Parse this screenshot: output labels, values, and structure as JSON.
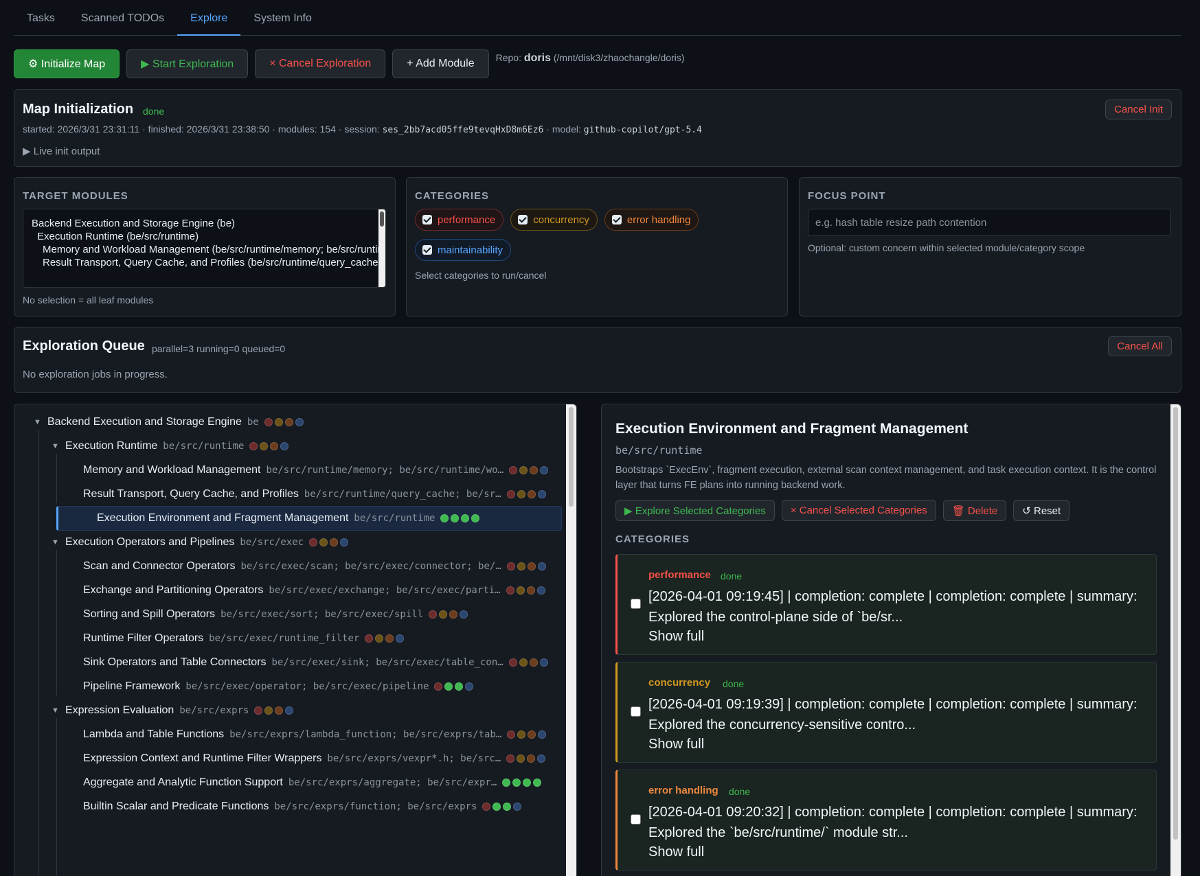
{
  "tabs": [
    "Tasks",
    "Scanned TODOs",
    "Explore",
    "System Info"
  ],
  "toolbar": {
    "init_label": "⚙ Initialize Map",
    "start_label": "▶ Start Exploration",
    "cancel_label": "× Cancel Exploration",
    "add_label": "+ Add Module",
    "repo_prefix": "Repo:",
    "repo_name": "doris",
    "repo_path": "(/mnt/disk3/zhaochangle/doris)"
  },
  "init": {
    "title": "Map Initialization",
    "status": "done",
    "started_label": "started:",
    "started": "2026/3/31 23:31:11",
    "finished_label": "· finished:",
    "finished": "2026/3/31 23:38:50",
    "modules_label": "· modules:",
    "modules": "154",
    "session_label": "· session:",
    "session": "ses_2bb7acd05ffe9tevqHxD8m6Ez6",
    "model_label": "· model:",
    "model": "github-copilot/gpt-5.4",
    "live_output": "▶ Live init output",
    "cancel_label": "Cancel Init"
  },
  "target": {
    "label": "TARGET MODULES",
    "items": [
      "Backend Execution and Storage Engine (be)",
      "Execution Runtime (be/src/runtime)",
      "Memory and Workload Management (be/src/runtime/memory; be/src/runtime/workload_management)",
      "Result Transport, Query Cache, and Profiles (be/src/runtime/query_cache; be/src/runtime/result)"
    ],
    "hint": "No selection = all leaf modules"
  },
  "categories": {
    "label": "CATEGORIES",
    "items": [
      "performance",
      "concurrency",
      "error handling",
      "maintainability"
    ],
    "hint": "Select categories to run/cancel"
  },
  "focus": {
    "label": "FOCUS POINT",
    "placeholder": "e.g. hash table resize path contention",
    "hint": "Optional: custom concern within selected module/category scope"
  },
  "queue": {
    "title": "Exploration Queue",
    "stats": "parallel=3 running=0 queued=0",
    "empty": "No exploration jobs in progress.",
    "cancel_label": "Cancel All"
  },
  "colors": {
    "red": "#da3633",
    "amber": "#bb8009",
    "orange": "#bd561d",
    "blue": "#1f6feb",
    "red_dim": "#6e2b2b",
    "amber_dim": "#6b5216",
    "orange_dim": "#6c3c1c",
    "blue_dim": "#2a4670",
    "green": "#3fb950"
  },
  "tree": [
    {
      "level": 0,
      "caret": "▼",
      "name": "Backend Execution and Storage Engine",
      "path": "be",
      "dots": [
        "red_dim",
        "amber_dim",
        "orange_dim",
        "blue_dim"
      ]
    },
    {
      "level": 1,
      "caret": "▼",
      "name": "Execution Runtime",
      "path": "be/src/runtime",
      "dots": [
        "red_dim",
        "amber_dim",
        "orange_dim",
        "blue_dim"
      ]
    },
    {
      "level": 2,
      "caret": "",
      "name": "Memory and Workload Management",
      "path": "be/src/runtime/memory; be/src/runtime/wo…",
      "dots": [
        "red_dim",
        "amber_dim",
        "orange_dim",
        "blue_dim"
      ]
    },
    {
      "level": 2,
      "caret": "",
      "name": "Result Transport, Query Cache, and Profiles",
      "path": "be/src/runtime/query_cache; be/sr…",
      "dots": [
        "red_dim",
        "amber_dim",
        "orange_dim",
        "blue_dim"
      ]
    },
    {
      "level": 2,
      "caret": "",
      "name": "Execution Environment and Fragment Management",
      "path": "be/src/runtime",
      "dots": [
        "green",
        "green",
        "green",
        "green"
      ],
      "selected": true
    },
    {
      "level": 1,
      "caret": "▼",
      "name": "Execution Operators and Pipelines",
      "path": "be/src/exec",
      "dots": [
        "red_dim",
        "amber_dim",
        "orange_dim",
        "blue_dim"
      ]
    },
    {
      "level": 2,
      "caret": "",
      "name": "Scan and Connector Operators",
      "path": "be/src/exec/scan; be/src/exec/connector; be/…",
      "dots": [
        "red_dim",
        "amber_dim",
        "orange_dim",
        "blue_dim"
      ]
    },
    {
      "level": 2,
      "caret": "",
      "name": "Exchange and Partitioning Operators",
      "path": "be/src/exec/exchange; be/src/exec/parti…",
      "dots": [
        "red_dim",
        "amber_dim",
        "orange_dim",
        "blue_dim"
      ]
    },
    {
      "level": 2,
      "caret": "",
      "name": "Sorting and Spill Operators",
      "path": "be/src/exec/sort; be/src/exec/spill",
      "dots": [
        "red_dim",
        "amber_dim",
        "orange_dim",
        "blue_dim"
      ]
    },
    {
      "level": 2,
      "caret": "",
      "name": "Runtime Filter Operators",
      "path": "be/src/exec/runtime_filter",
      "dots": [
        "red_dim",
        "amber_dim",
        "orange_dim",
        "blue_dim"
      ]
    },
    {
      "level": 2,
      "caret": "",
      "name": "Sink Operators and Table Connectors",
      "path": "be/src/exec/sink; be/src/exec/table_con…",
      "dots": [
        "red_dim",
        "amber_dim",
        "orange_dim",
        "blue_dim"
      ]
    },
    {
      "level": 2,
      "caret": "",
      "name": "Pipeline Framework",
      "path": "be/src/exec/operator; be/src/exec/pipeline",
      "dots": [
        "red_dim",
        "green",
        "green",
        "blue_dim"
      ]
    },
    {
      "level": 1,
      "caret": "▼",
      "name": "Expression Evaluation",
      "path": "be/src/exprs",
      "dots": [
        "red_dim",
        "amber_dim",
        "orange_dim",
        "blue_dim"
      ]
    },
    {
      "level": 2,
      "caret": "",
      "name": "Lambda and Table Functions",
      "path": "be/src/exprs/lambda_function; be/src/exprs/tab…",
      "dots": [
        "red_dim",
        "amber_dim",
        "orange_dim",
        "blue_dim"
      ]
    },
    {
      "level": 2,
      "caret": "",
      "name": "Expression Context and Runtime Filter Wrappers",
      "path": "be/src/exprs/vexpr*.h; be/src…",
      "dots": [
        "red_dim",
        "amber_dim",
        "orange_dim",
        "blue_dim"
      ]
    },
    {
      "level": 2,
      "caret": "",
      "name": "Aggregate and Analytic Function Support",
      "path": "be/src/exprs/aggregate; be/src/expr…",
      "dots": [
        "green",
        "green",
        "green",
        "green"
      ]
    },
    {
      "level": 2,
      "caret": "",
      "name": "Builtin Scalar and Predicate Functions",
      "path": "be/src/exprs/function; be/src/exprs",
      "dots": [
        "red_dim",
        "green",
        "green",
        "blue_dim"
      ]
    }
  ],
  "detail": {
    "title": "Execution Environment and Fragment Management",
    "path": "be/src/runtime",
    "description": "Bootstraps `ExecEnv`, fragment execution, external scan context management, and task execution context. It is the control layer that turns FE plans into running backend work.",
    "explore_label": "▶ Explore Selected Categories",
    "cancel_label": "× Cancel Selected Categories",
    "delete_label": "🗑 Delete",
    "reset_label": "↺ Reset",
    "categories_label": "CATEGORIES",
    "cards": [
      {
        "name": "performance",
        "status": "done",
        "accent": "#f85149",
        "summary": "[2026-04-01 09:19:45] | completion: complete | completion: complete | summary: Explored the control-plane side of `be/sr...",
        "show": "Show full"
      },
      {
        "name": "concurrency",
        "status": "done",
        "accent": "#d29922",
        "summary": "[2026-04-01 09:19:39] | completion: complete | completion: complete | summary: Explored the concurrency-sensitive contro...",
        "show": "Show full"
      },
      {
        "name": "error handling",
        "status": "done",
        "accent": "#f0883e",
        "summary": "[2026-04-01 09:20:32] | completion: complete | completion: complete | summary: Explored the `be/src/runtime/` module str...",
        "show": "Show full"
      }
    ]
  }
}
